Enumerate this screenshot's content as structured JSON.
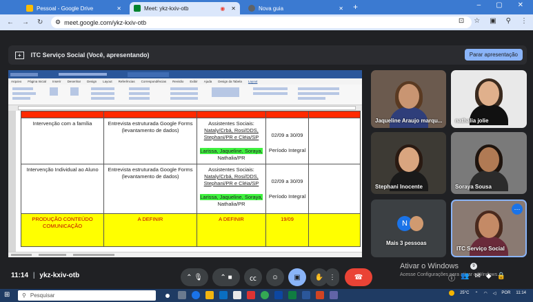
{
  "browser": {
    "tabs": [
      {
        "label": "Pessoal - Google Drive",
        "active": false
      },
      {
        "label": "Meet: ykz-kxiv-otb",
        "active": true
      },
      {
        "label": "Nova guia",
        "active": false
      }
    ],
    "url": "meet.google.com/ykz-kxiv-otb"
  },
  "meet": {
    "presenting_label": "ITC Serviço Social (Você, apresentando)",
    "stop_button": "Parar apresentação",
    "clock": "11:14",
    "meeting_code": "ykz-kxiv-otb",
    "participants": [
      {
        "name": "Jaqueline Araujo marqu..."
      },
      {
        "name": "nathalia jolie"
      },
      {
        "name": "Stephani Inocente"
      },
      {
        "name": "Soraya Sousa"
      },
      {
        "name": "Mais 3 pessoas",
        "avatar_letter": "N"
      },
      {
        "name": "ITC Serviço Social"
      }
    ]
  },
  "document": {
    "ribbon_tabs": [
      "Arquivo",
      "Página Inicial",
      "Inserir",
      "Desenhar",
      "Design",
      "Layout",
      "Referências",
      "Correspondências",
      "Revisão",
      "Exibir",
      "Ajuda",
      "Design da Tabela",
      "Layout"
    ],
    "rows": [
      {
        "activity": "Intervenção com a família",
        "tool": "Entrevista estruturada Google Forms (levantamento de dados)",
        "resp_head": "Assistentes Sociais:",
        "resp_line1": "Nataly/Crbá, Rosi/DDS,",
        "resp_line2": "Stephani/PR e Cléia/SP",
        "resp_hl": "Larissa, Jaqueline, Soraya,",
        "resp_tail": "Nathalia/PR",
        "date": "02/09 a 30/09",
        "period": "Período Integral"
      },
      {
        "activity": "Intervenção Individual ao Aluno",
        "tool": "Entrevista estruturada Google Forms (levantamento de dados)",
        "resp_head": "Assistentes Sociais:",
        "resp_line1": "Nataly/Crbá, Rosi/DDS,",
        "resp_line2": "Stephani/PR e Cléia/SP",
        "resp_hl": "Larissa, Jaqueline, Soraya,",
        "resp_tail": "Nathalia/PR",
        "date": "02/09 a 30/09",
        "period": "Período Integral"
      },
      {
        "activity": "PRODUÇÃO CONTEÚDO COMUNICAÇÃO",
        "tool": "A DEFINIR",
        "resp": "A DEFINIR",
        "date": "19/09"
      }
    ]
  },
  "windows": {
    "activate_title": "Ativar o Windows",
    "activate_sub": "Acesse Configurações para ativar o Windows.",
    "search_placeholder": "Pesquisar",
    "tray_temp": "25°C",
    "tray_lang": "POR",
    "tray_time": "11:14"
  },
  "colors": {
    "meet_bg": "#202124",
    "accent": "#8ab4f8",
    "end_call": "#ea4335",
    "highlight": "#3ff13f",
    "yellow_row": "#ffff00"
  }
}
